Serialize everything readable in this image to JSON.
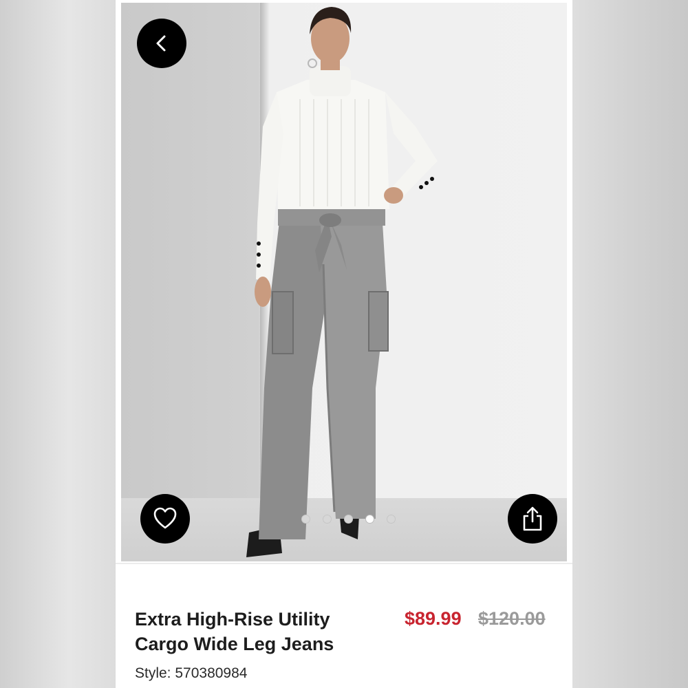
{
  "hero": {
    "image_alt": "Model wearing white turtleneck and grey cargo wide leg jeans",
    "carousel": {
      "count": 5,
      "active_index": 3
    }
  },
  "icons": {
    "back": "chevron-left-icon",
    "favorite": "heart-outline-icon",
    "share": "share-icon"
  },
  "product": {
    "name_line1": "Extra High-Rise Utility",
    "name_line2": "Cargo Wide Leg Jeans",
    "sale_price": "$89.99",
    "original_price": "$120.00",
    "style_label": "Style: 570380984"
  },
  "colors": {
    "sale_price": "#c8242f",
    "original_price": "#9a9a9a",
    "button_bg": "#000000"
  }
}
